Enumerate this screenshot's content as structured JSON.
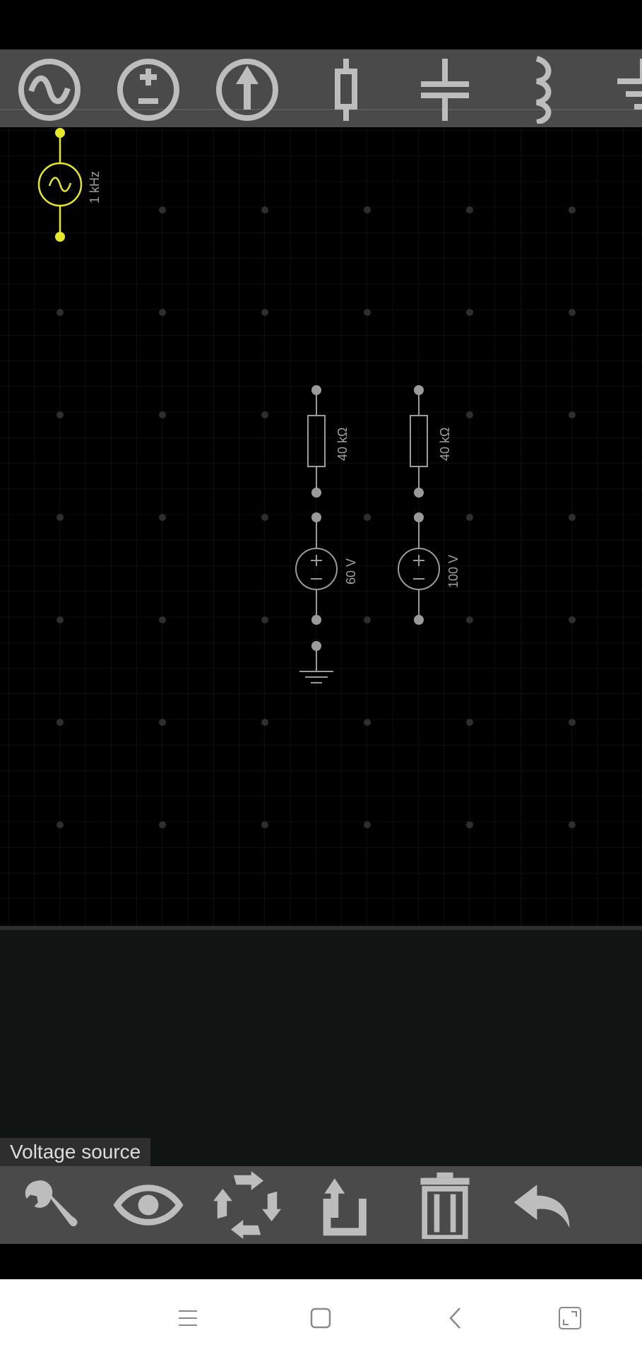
{
  "toolbar": {
    "tools": [
      {
        "icon": "ac-source-icon"
      },
      {
        "icon": "dc-voltage-source-icon"
      },
      {
        "icon": "current-source-icon"
      },
      {
        "icon": "resistor-icon"
      },
      {
        "icon": "capacitor-icon"
      },
      {
        "icon": "inductor-icon"
      },
      {
        "icon": "ground-icon"
      }
    ]
  },
  "circuit": {
    "ac_source": {
      "label": "1 kHz",
      "color": "#e8e82a"
    },
    "resistor_1": {
      "label": "40 kΩ"
    },
    "resistor_2": {
      "label": "40 kΩ"
    },
    "source_1": {
      "label": "60 V"
    },
    "source_2": {
      "label": "100 V"
    },
    "component_color": "#9a9a9a"
  },
  "status": {
    "selected": "Voltage source"
  },
  "actionbar": {
    "actions": [
      {
        "icon": "wrench-icon"
      },
      {
        "icon": "eye-icon"
      },
      {
        "icon": "rotate-icon"
      },
      {
        "icon": "flip-icon"
      },
      {
        "icon": "trash-icon"
      },
      {
        "icon": "undo-icon"
      }
    ]
  },
  "navbar": {
    "buttons": [
      {
        "icon": "menu-icon"
      },
      {
        "icon": "home-square-icon"
      },
      {
        "icon": "back-chevron-icon"
      },
      {
        "icon": "expand-icon"
      }
    ]
  }
}
